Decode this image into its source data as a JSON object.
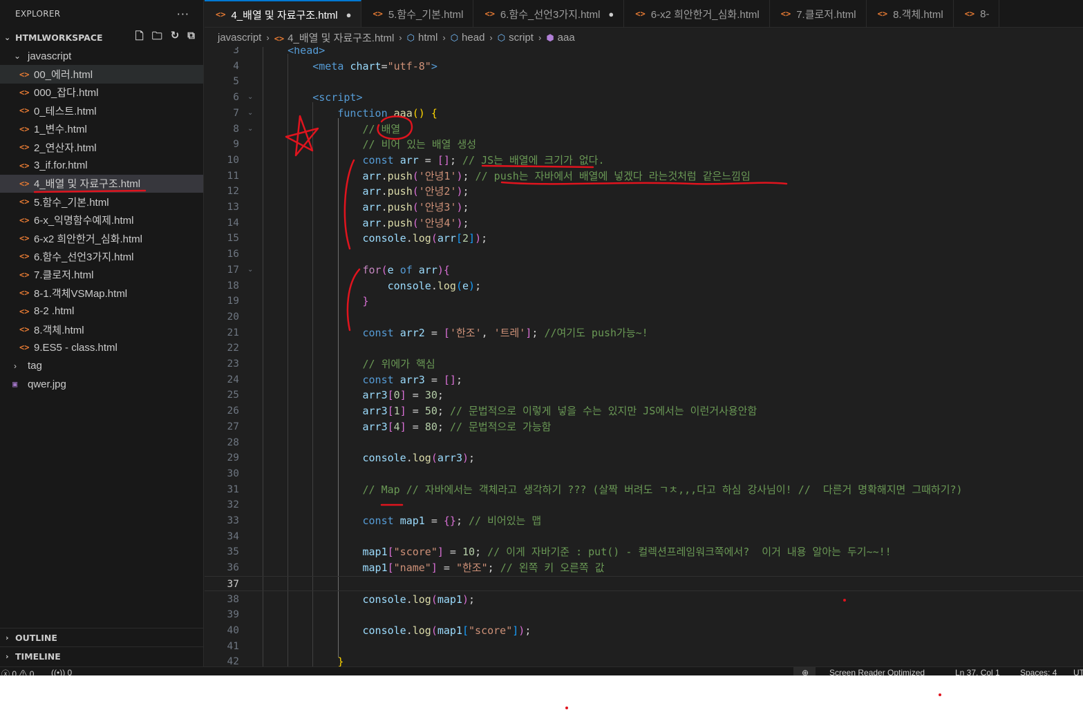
{
  "sidebar": {
    "title": "EXPLORER",
    "more_icon": "ellipsis-icon",
    "workspace": "HTMLWORKSPACE",
    "actions": [
      "new-file-icon",
      "new-folder-icon",
      "refresh-icon",
      "collapse-all-icon"
    ],
    "folder": "javascript",
    "files": [
      "00_에러.html",
      "000_잡다.html",
      "0_테스트.html",
      "1_변수.html",
      "2_연산자.html",
      "3_if.for.html",
      "4_배열 및 자료구조.html",
      "5.함수_기본.html",
      "6-x_익명함수예제.html",
      "6-x2 희안한거_심화.html",
      "6.함수_선언3가지.html",
      "7.클로저.html",
      "8-1.객체VSMap.html",
      "8-2 .html",
      "8.객체.html",
      "9.ES5 - class.html"
    ],
    "other_folder": "tag",
    "image_file": "qwer.jpg",
    "outline": "OUTLINE",
    "timeline": "TIMELINE"
  },
  "tabs": [
    {
      "label": "4_배열 및 자료구조.html",
      "modified": "●"
    },
    {
      "label": "5.함수_기본.html",
      "modified": ""
    },
    {
      "label": "6.함수_선언3가지.html",
      "modified": "●"
    },
    {
      "label": "6-x2 희안한거_심화.html",
      "modified": ""
    },
    {
      "label": "7.클로저.html",
      "modified": ""
    },
    {
      "label": "8.객체.html",
      "modified": ""
    },
    {
      "label": "8-",
      "modified": ""
    }
  ],
  "breadcrumb": [
    "javascript",
    "4_배열 및 자료구조.html",
    "html",
    "head",
    "script",
    "aaa"
  ],
  "editor": {
    "current_line": 37,
    "lines": [
      {
        "n": "3",
        "tokens": [
          [
            "",
            "    "
          ],
          [
            "tag",
            "<head>"
          ]
        ]
      },
      {
        "n": "4",
        "tokens": [
          [
            "",
            "        "
          ],
          [
            "tag",
            "<meta"
          ],
          [
            "plain",
            " "
          ],
          [
            "attr",
            "chart"
          ],
          [
            "plain",
            "="
          ],
          [
            "str",
            "\"utf-8\""
          ],
          [
            "tag",
            ">"
          ]
        ]
      },
      {
        "n": "5",
        "tokens": []
      },
      {
        "n": "6",
        "tokens": [
          [
            "",
            "        "
          ],
          [
            "tag",
            "<script>"
          ]
        ]
      },
      {
        "n": "7",
        "tokens": [
          [
            "",
            "            "
          ],
          [
            "kw",
            "function"
          ],
          [
            "plain",
            " "
          ],
          [
            "fn",
            "aaa"
          ],
          [
            "br1",
            "()"
          ],
          [
            "plain",
            " "
          ],
          [
            "br1",
            "{"
          ]
        ]
      },
      {
        "n": "8",
        "tokens": [
          [
            "",
            "                "
          ],
          [
            "cmt",
            "// 배열"
          ]
        ]
      },
      {
        "n": "9",
        "tokens": [
          [
            "",
            "                "
          ],
          [
            "cmt",
            "// 비어 있는 배열 생성"
          ]
        ]
      },
      {
        "n": "10",
        "tokens": [
          [
            "",
            "                "
          ],
          [
            "kw",
            "const"
          ],
          [
            "plain",
            " "
          ],
          [
            "var",
            "arr"
          ],
          [
            "plain",
            " = "
          ],
          [
            "br2",
            "[]"
          ],
          [
            "plain",
            "; "
          ],
          [
            "cmt",
            "// JS는 배열에 크기가 없다."
          ]
        ]
      },
      {
        "n": "11",
        "tokens": [
          [
            "",
            "                "
          ],
          [
            "var",
            "arr"
          ],
          [
            "plain",
            "."
          ],
          [
            "fn",
            "push"
          ],
          [
            "br2",
            "("
          ],
          [
            "str",
            "'안녕1'"
          ],
          [
            "br2",
            ")"
          ],
          [
            "plain",
            "; "
          ],
          [
            "cmt",
            "// push는 자바에서 배열에 넣겠다 라는것처럼 같은느낌임"
          ]
        ]
      },
      {
        "n": "12",
        "tokens": [
          [
            "",
            "                "
          ],
          [
            "var",
            "arr"
          ],
          [
            "plain",
            "."
          ],
          [
            "fn",
            "push"
          ],
          [
            "br2",
            "("
          ],
          [
            "str",
            "'안녕2'"
          ],
          [
            "br2",
            ")"
          ],
          [
            "plain",
            ";"
          ]
        ]
      },
      {
        "n": "13",
        "tokens": [
          [
            "",
            "                "
          ],
          [
            "var",
            "arr"
          ],
          [
            "plain",
            "."
          ],
          [
            "fn",
            "push"
          ],
          [
            "br2",
            "("
          ],
          [
            "str",
            "'안녕3'"
          ],
          [
            "br2",
            ")"
          ],
          [
            "plain",
            ";"
          ]
        ]
      },
      {
        "n": "14",
        "tokens": [
          [
            "",
            "                "
          ],
          [
            "var",
            "arr"
          ],
          [
            "plain",
            "."
          ],
          [
            "fn",
            "push"
          ],
          [
            "br2",
            "("
          ],
          [
            "str",
            "'안녕4'"
          ],
          [
            "br2",
            ")"
          ],
          [
            "plain",
            ";"
          ]
        ]
      },
      {
        "n": "15",
        "tokens": [
          [
            "",
            "                "
          ],
          [
            "var",
            "console"
          ],
          [
            "plain",
            "."
          ],
          [
            "fn",
            "log"
          ],
          [
            "br2",
            "("
          ],
          [
            "var",
            "arr"
          ],
          [
            "br3",
            "["
          ],
          [
            "num",
            "2"
          ],
          [
            "br3",
            "]"
          ],
          [
            "br2",
            ")"
          ],
          [
            "plain",
            ";"
          ]
        ]
      },
      {
        "n": "16",
        "tokens": []
      },
      {
        "n": "17",
        "tokens": [
          [
            "",
            "                "
          ],
          [
            "kw2",
            "for"
          ],
          [
            "br2",
            "("
          ],
          [
            "var",
            "e"
          ],
          [
            "plain",
            " "
          ],
          [
            "kw",
            "of"
          ],
          [
            "plain",
            " "
          ],
          [
            "var",
            "arr"
          ],
          [
            "br2",
            ")"
          ],
          [
            "br2",
            "{"
          ]
        ]
      },
      {
        "n": "18",
        "tokens": [
          [
            "",
            "                    "
          ],
          [
            "var",
            "console"
          ],
          [
            "plain",
            "."
          ],
          [
            "fn",
            "log"
          ],
          [
            "br3",
            "("
          ],
          [
            "var",
            "e"
          ],
          [
            "br3",
            ")"
          ],
          [
            "plain",
            ";"
          ]
        ]
      },
      {
        "n": "19",
        "tokens": [
          [
            "",
            "                "
          ],
          [
            "br2",
            "}"
          ]
        ]
      },
      {
        "n": "20",
        "tokens": []
      },
      {
        "n": "21",
        "tokens": [
          [
            "",
            "                "
          ],
          [
            "kw",
            "const"
          ],
          [
            "plain",
            " "
          ],
          [
            "var",
            "arr2"
          ],
          [
            "plain",
            " = "
          ],
          [
            "br2",
            "["
          ],
          [
            "str",
            "'한조'"
          ],
          [
            "plain",
            ", "
          ],
          [
            "str",
            "'트레'"
          ],
          [
            "br2",
            "]"
          ],
          [
            "plain",
            "; "
          ],
          [
            "cmt",
            "//여기도 push가능~!"
          ]
        ]
      },
      {
        "n": "22",
        "tokens": []
      },
      {
        "n": "23",
        "tokens": [
          [
            "",
            "                "
          ],
          [
            "cmt",
            "// 위에가 핵심"
          ]
        ]
      },
      {
        "n": "24",
        "tokens": [
          [
            "",
            "                "
          ],
          [
            "kw",
            "const"
          ],
          [
            "plain",
            " "
          ],
          [
            "var",
            "arr3"
          ],
          [
            "plain",
            " = "
          ],
          [
            "br2",
            "[]"
          ],
          [
            "plain",
            ";"
          ]
        ]
      },
      {
        "n": "25",
        "tokens": [
          [
            "",
            "                "
          ],
          [
            "var",
            "arr3"
          ],
          [
            "br2",
            "["
          ],
          [
            "num",
            "0"
          ],
          [
            "br2",
            "]"
          ],
          [
            "plain",
            " = "
          ],
          [
            "num",
            "30"
          ],
          [
            "plain",
            ";"
          ]
        ]
      },
      {
        "n": "26",
        "tokens": [
          [
            "",
            "                "
          ],
          [
            "var",
            "arr3"
          ],
          [
            "br2",
            "["
          ],
          [
            "num",
            "1"
          ],
          [
            "br2",
            "]"
          ],
          [
            "plain",
            " = "
          ],
          [
            "num",
            "50"
          ],
          [
            "plain",
            "; "
          ],
          [
            "cmt",
            "// 문법적으로 이렇게 넣을 수는 있지만 JS에서는 이런거사용안함"
          ]
        ]
      },
      {
        "n": "27",
        "tokens": [
          [
            "",
            "                "
          ],
          [
            "var",
            "arr3"
          ],
          [
            "br2",
            "["
          ],
          [
            "num",
            "4"
          ],
          [
            "br2",
            "]"
          ],
          [
            "plain",
            " = "
          ],
          [
            "num",
            "80"
          ],
          [
            "plain",
            "; "
          ],
          [
            "cmt",
            "// 문법적으로 가능함"
          ]
        ]
      },
      {
        "n": "28",
        "tokens": []
      },
      {
        "n": "29",
        "tokens": [
          [
            "",
            "                "
          ],
          [
            "var",
            "console"
          ],
          [
            "plain",
            "."
          ],
          [
            "fn",
            "log"
          ],
          [
            "br2",
            "("
          ],
          [
            "var",
            "arr3"
          ],
          [
            "br2",
            ")"
          ],
          [
            "plain",
            ";"
          ]
        ]
      },
      {
        "n": "30",
        "tokens": []
      },
      {
        "n": "31",
        "tokens": [
          [
            "",
            "                "
          ],
          [
            "cmt",
            "// Map // 자바에서는 객체라고 생각하기 ??? (살짝 버려도 ㄱㅊ,,,다고 하심 강사님이! //  다른거 명확해지면 그때하기?)"
          ]
        ]
      },
      {
        "n": "32",
        "tokens": []
      },
      {
        "n": "33",
        "tokens": [
          [
            "",
            "                "
          ],
          [
            "kw",
            "const"
          ],
          [
            "plain",
            " "
          ],
          [
            "var",
            "map1"
          ],
          [
            "plain",
            " = "
          ],
          [
            "br2",
            "{}"
          ],
          [
            "plain",
            "; "
          ],
          [
            "cmt",
            "// 비어있는 맵"
          ]
        ]
      },
      {
        "n": "34",
        "tokens": []
      },
      {
        "n": "35",
        "tokens": [
          [
            "",
            "                "
          ],
          [
            "var",
            "map1"
          ],
          [
            "br2",
            "["
          ],
          [
            "str",
            "\"score\""
          ],
          [
            "br2",
            "]"
          ],
          [
            "plain",
            " = "
          ],
          [
            "num",
            "10"
          ],
          [
            "plain",
            "; "
          ],
          [
            "cmt",
            "// 이게 자바기준 : put() - 컬렉션프레임워크쪽에서?  이거 내용 알아는 두기~~!!"
          ]
        ]
      },
      {
        "n": "36",
        "tokens": [
          [
            "",
            "                "
          ],
          [
            "var",
            "map1"
          ],
          [
            "br2",
            "["
          ],
          [
            "str",
            "\"name\""
          ],
          [
            "br2",
            "]"
          ],
          [
            "plain",
            " = "
          ],
          [
            "str",
            "\"한조\""
          ],
          [
            "plain",
            "; "
          ],
          [
            "cmt",
            "// 왼쪽 키 오른쪽 값"
          ]
        ]
      },
      {
        "n": "37",
        "tokens": []
      },
      {
        "n": "38",
        "tokens": [
          [
            "",
            "                "
          ],
          [
            "var",
            "console"
          ],
          [
            "plain",
            "."
          ],
          [
            "fn",
            "log"
          ],
          [
            "br2",
            "("
          ],
          [
            "var",
            "map1"
          ],
          [
            "br2",
            ")"
          ],
          [
            "plain",
            ";"
          ]
        ]
      },
      {
        "n": "39",
        "tokens": []
      },
      {
        "n": "40",
        "tokens": [
          [
            "",
            "                "
          ],
          [
            "var",
            "console"
          ],
          [
            "plain",
            "."
          ],
          [
            "fn",
            "log"
          ],
          [
            "br2",
            "("
          ],
          [
            "var",
            "map1"
          ],
          [
            "br3",
            "["
          ],
          [
            "str",
            "\"score\""
          ],
          [
            "br3",
            "]"
          ],
          [
            "br2",
            ")"
          ],
          [
            "plain",
            ";"
          ]
        ]
      },
      {
        "n": "41",
        "tokens": []
      },
      {
        "n": "42",
        "tokens": [
          [
            "",
            "            "
          ],
          [
            "br1",
            "}"
          ]
        ]
      }
    ]
  },
  "statusbar": {
    "errors": "0",
    "warnings": "0",
    "ports": "0",
    "screen_reader": "Screen Reader Optimized",
    "position": "Ln 37, Col 1",
    "spaces": "Spaces: 4",
    "encoding": "UT"
  },
  "annotation_color": "#e0141e"
}
